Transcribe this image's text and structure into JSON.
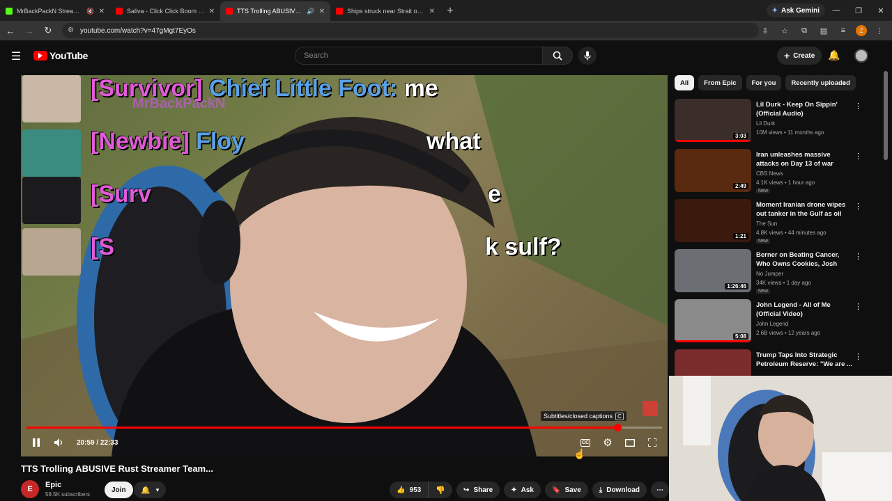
{
  "browser": {
    "tabs": [
      {
        "title": "MrBackPackN Stream - Wa",
        "favicon_color": "#53fc18",
        "muted": true,
        "active": false
      },
      {
        "title": "Saliva - Click Click Boom (Offici",
        "favicon_color": "#ff0000",
        "muted": false,
        "active": false
      },
      {
        "title": "TTS Trolling ABUSIVE Rust S",
        "favicon_color": "#ff0000",
        "muted": false,
        "active": true
      },
      {
        "title": "Ships struck near Strait of Horm",
        "favicon_color": "#ff0000",
        "muted": false,
        "active": false
      }
    ],
    "new_tab": "+",
    "ask_gemini": "Ask Gemini",
    "url": "youtube.com/watch?v=47gMgt7EyOs",
    "profile_initial": "Z"
  },
  "youtube": {
    "logo_text": "YouTube",
    "search_placeholder": "Search",
    "create_label": "Create",
    "player": {
      "chat": [
        {
          "tag": "[Survivor]",
          "name": "Chief Little Foot:",
          "msg": "me"
        },
        {
          "tag": "[Newbie]",
          "name": "Floy",
          "msg": "what"
        },
        {
          "tag": "[Surv",
          "name": "",
          "msg": "e"
        },
        {
          "tag": "[S",
          "name": "",
          "msg": "k sulf?"
        }
      ],
      "watermark": "MrBackPackN",
      "time_current": "20:59",
      "time_total": "22:33",
      "time_display": "20:59 / 22:33",
      "progress": 0.93,
      "tooltip": "Subtitles/closed captions",
      "tooltip_key": "C",
      "cc_label": "CC"
    },
    "video": {
      "title": "TTS Trolling ABUSIVE Rust Streamer Team...",
      "channel": "Epic",
      "channel_initial": "E",
      "subscribers": "58.5K subscribers",
      "join_label": "Join",
      "likes": "953",
      "share_label": "Share",
      "ask_label": "Ask",
      "save_label": "Save",
      "download_label": "Download"
    },
    "chips": [
      {
        "label": "All",
        "selected": true
      },
      {
        "label": "From Epic",
        "selected": false
      },
      {
        "label": "For you",
        "selected": false
      },
      {
        "label": "Recently uploaded",
        "selected": false
      }
    ],
    "recommendations": [
      {
        "title": "Lil Durk - Keep On Sippin' (Official Audio)",
        "channel": "Lil Durk",
        "meta": "10M views • 11 months ago",
        "duration": "3:03",
        "new": "",
        "watched": 1.0,
        "thumb": "#3a2d2a"
      },
      {
        "title": "Iran unleashes massive attacks on Day 13 of war",
        "channel": "CBS News",
        "meta": "4.1K views • 1 hour ago",
        "duration": "2:49",
        "new": "New",
        "watched": 0,
        "thumb": "#5a2a10"
      },
      {
        "title": "Moment Iranian drone wipes out tanker in the Gulf as oil prices ...",
        "channel": "The Sun",
        "meta": "4.8K views • 44 minutes ago",
        "duration": "1:21",
        "new": "New",
        "watched": 0,
        "thumb": "#3b1a0d"
      },
      {
        "title": "Berner on Beating Cancer, Who Owns Cookies, Josh from RA...",
        "channel": "No Jumper",
        "meta": "34K views • 1 day ago",
        "duration": "1:26:46",
        "new": "New",
        "watched": 0,
        "thumb": "#6b6e73"
      },
      {
        "title": "John Legend - All of Me (Official Video)",
        "channel": "John Legend",
        "meta": "2.6B views • 12 years ago",
        "duration": "5:08",
        "new": "",
        "watched": 1.0,
        "thumb": "#8a8a8a"
      },
      {
        "title": "Trump Taps Into Strategic Petroleum Reserve: \"We are ...",
        "channel": "",
        "meta": "",
        "duration": "",
        "new": "",
        "watched": 0,
        "thumb": "#7a2b2b"
      }
    ]
  }
}
